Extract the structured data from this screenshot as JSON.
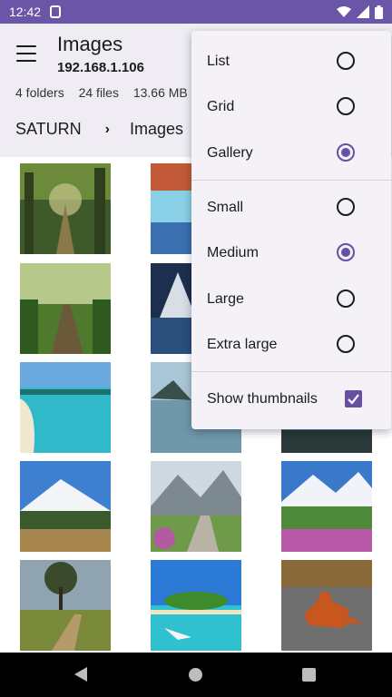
{
  "status_bar": {
    "time": "12:42",
    "icons": [
      "sim-icon",
      "wifi-icon",
      "signal-icon",
      "battery-icon"
    ]
  },
  "header": {
    "title": "Images",
    "subtitle": "192.168.1.106",
    "stats": {
      "folders": "4 folders",
      "files": "24 files",
      "size": "13.66 MB"
    },
    "breadcrumb": {
      "root": "SATURN",
      "separator": "›",
      "current": "Images"
    }
  },
  "menu": {
    "view_options": [
      {
        "label": "List",
        "selected": false
      },
      {
        "label": "Grid",
        "selected": false
      },
      {
        "label": "Gallery",
        "selected": true
      }
    ],
    "size_options": [
      {
        "label": "Small",
        "selected": false
      },
      {
        "label": "Medium",
        "selected": true
      },
      {
        "label": "Large",
        "selected": false
      },
      {
        "label": "Extra large",
        "selected": false
      }
    ],
    "show_thumbnails": {
      "label": "Show thumbnails",
      "checked": true
    }
  },
  "colors": {
    "status_bar": "#6b55a6",
    "header_bg": "#efecf4",
    "accent": "#6750a4",
    "nav_bar": "#000000"
  },
  "grid": {
    "thumbnails": [
      "forest-path",
      "waterfall",
      "forest-bridge-path",
      "mountain-night-lake",
      "tropical-beach",
      "lake-reflection",
      "mount-fuji-field",
      "snowy-mountain-stone-path",
      "snowy-mountains-flowers",
      "tree-dirt-path",
      "tropical-island",
      "red-fox"
    ]
  },
  "nav": {
    "icons": [
      "back-icon",
      "home-icon",
      "recents-icon"
    ]
  }
}
